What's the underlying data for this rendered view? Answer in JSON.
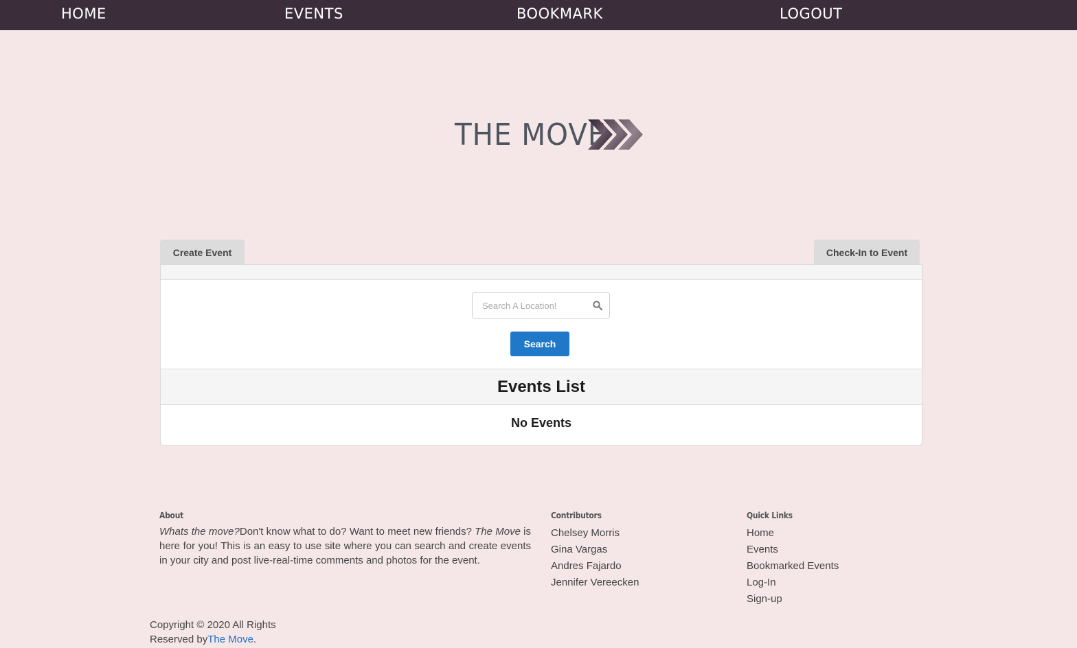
{
  "nav": {
    "home": "HOME",
    "events": "EVENTS",
    "bookmark": "BOOKMARK",
    "logout": "LOGOUT"
  },
  "logo": {
    "text": "THE MOVE"
  },
  "tabs": {
    "create_event": "Create Event",
    "check_in": "Check-In to Event"
  },
  "search": {
    "placeholder": "Search A Location!",
    "value": "",
    "button_label": "Search"
  },
  "events": {
    "title": "Events List",
    "empty_text": "No Events"
  },
  "footer": {
    "about": {
      "heading": "About",
      "lead_italic": "Whats the move?",
      "text_1": "Don't know what to do? Want to meet new friends? ",
      "brand_italic": "The Move",
      "text_2": " is here for you! This is an easy to use site where you can search and create events in your city and post live-real-time comments and photos for the event."
    },
    "contributors": {
      "heading": "Contributors",
      "names": [
        "Chelsey Morris",
        "Gina Vargas",
        "Andres Fajardo",
        "Jennifer Vereecken"
      ]
    },
    "quick_links": {
      "heading": "Quick Links",
      "links": [
        "Home",
        "Events",
        "Bookmarked Events",
        "Log-In",
        "Sign-up"
      ]
    },
    "copyright": {
      "line_1": "Copyright © 2020 All Rights",
      "line_2": "Reserved by",
      "brand_link": "The Move",
      "period": "."
    }
  },
  "colors": {
    "nav_bg": "#3b2e3a",
    "page_bg": "#f5e7e8",
    "primary_button": "#1f78c8",
    "link": "#1f6fbf"
  },
  "icons": {
    "logo_arrows": "triple-chevron-right-icon",
    "search": "search-icon"
  }
}
